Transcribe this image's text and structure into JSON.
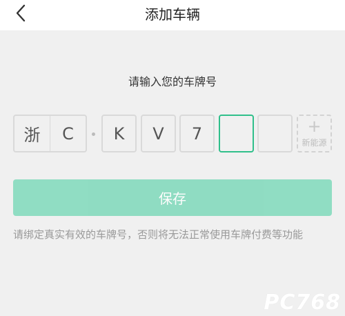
{
  "header": {
    "title": "添加车辆",
    "back_icon": "chevron-left-icon"
  },
  "prompt": "请输入您的车牌号",
  "plate": {
    "province": "浙",
    "letter": "C",
    "chars": [
      "K",
      "V",
      "7",
      "",
      ""
    ],
    "active_index": 3,
    "new_energy_label": "新能源",
    "new_energy_icon": "plus-icon"
  },
  "save_label": "保存",
  "notice": "请绑定真实有效的车牌号，否则将无法正常使用车牌付费等功能",
  "watermark": "PC768",
  "colors": {
    "accent": "#2fbf8a",
    "button": "#7fd9bb",
    "background": "#f0f0f0"
  }
}
